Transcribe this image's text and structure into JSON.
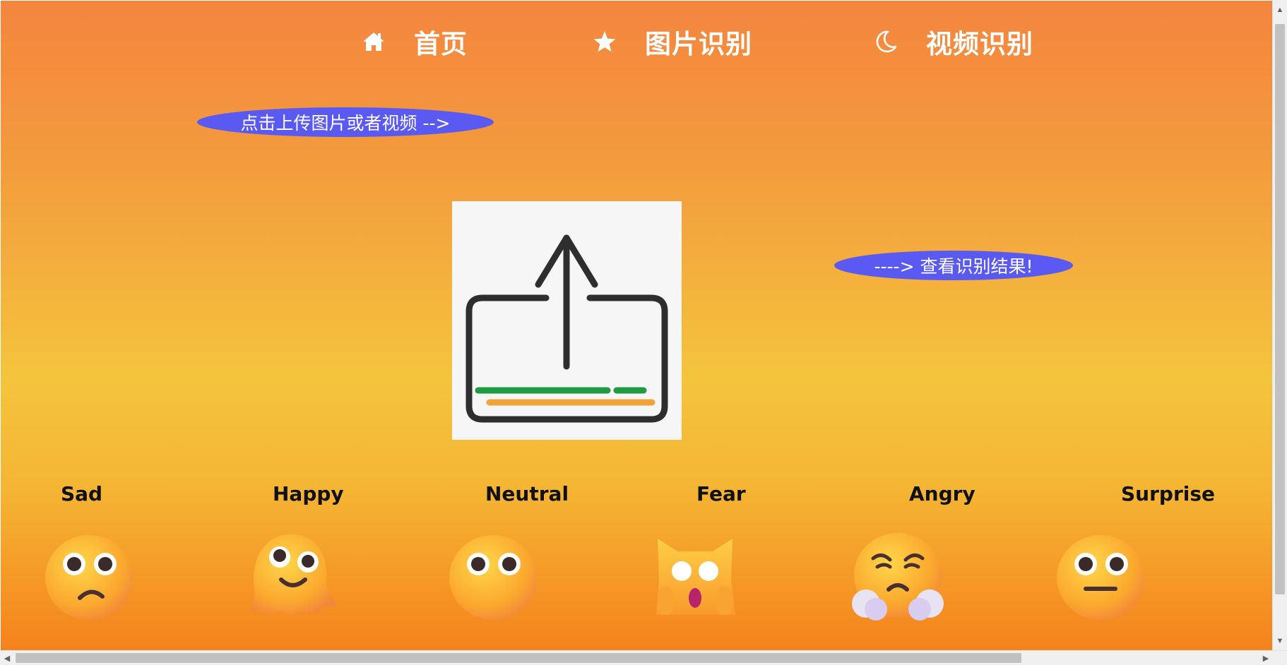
{
  "nav": {
    "items": [
      {
        "label": "首页",
        "icon": "home-icon"
      },
      {
        "label": "图片识别",
        "icon": "star-icon"
      },
      {
        "label": "视频识别",
        "icon": "moon-icon"
      }
    ]
  },
  "upload_hint": "点击上传图片或者视频 -->",
  "result_button": "----> 查看识别结果!",
  "upload_icon": "upload-icon",
  "emotions": [
    {
      "label": "Sad",
      "icon": "sad-face-icon"
    },
    {
      "label": "Happy",
      "icon": "melting-face-icon"
    },
    {
      "label": "Neutral",
      "icon": "neutral-face-icon"
    },
    {
      "label": "Fear",
      "icon": "fearful-cat-icon"
    },
    {
      "label": "Angry",
      "icon": "angry-steam-face-icon"
    },
    {
      "label": "Surprise",
      "icon": "expressionless-face-icon"
    }
  ],
  "colors": {
    "accent": "#5a59f2",
    "gradient_top": "#f4853f",
    "gradient_mid": "#f4c43d",
    "gradient_bottom": "#f5821c"
  }
}
